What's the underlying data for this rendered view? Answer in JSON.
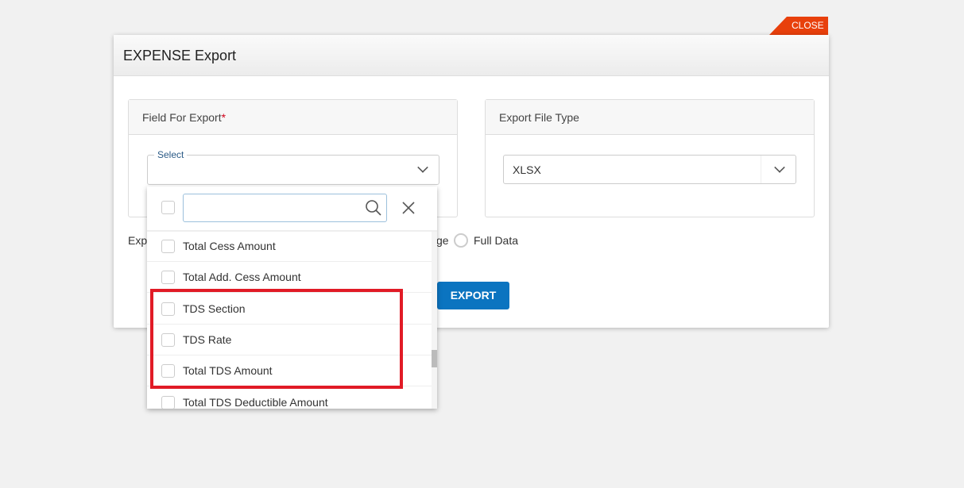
{
  "modal": {
    "title": "EXPENSE Export",
    "close_label": "CLOSE"
  },
  "field_panel": {
    "title": "Field For Export",
    "required_mark": "*",
    "select_legend": "Select"
  },
  "file_type_panel": {
    "title": "Export File Type",
    "selected": "XLSX"
  },
  "export_options": {
    "label_fragment": "Exp",
    "option_fragment": "ge",
    "full_data_label": "Full Data"
  },
  "export_button": "EXPORT",
  "dropdown": {
    "search_value": "",
    "items": [
      {
        "label": "Total Cess Amount",
        "checked": false
      },
      {
        "label": "Total Add. Cess Amount",
        "checked": false
      },
      {
        "label": "TDS Section",
        "checked": false
      },
      {
        "label": "TDS Rate",
        "checked": false
      },
      {
        "label": "Total TDS Amount",
        "checked": false
      },
      {
        "label": "Total TDS Deductible Amount",
        "checked": false
      }
    ]
  },
  "colors": {
    "accent": "#0b74c0",
    "close": "#e8400c",
    "highlight": "#e11b26"
  }
}
